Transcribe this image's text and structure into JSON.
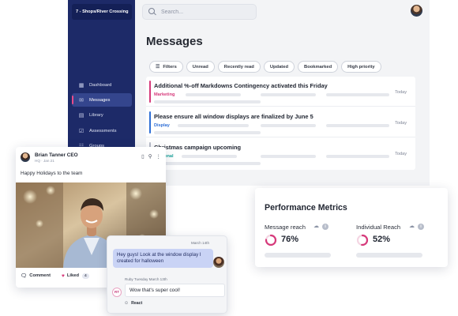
{
  "sidebar": {
    "store": "7 - Shops/River Crossing",
    "items": [
      {
        "label": "Dashboard",
        "icon": "dashboard-icon"
      },
      {
        "label": "Messages",
        "icon": "messages-icon",
        "active": true
      },
      {
        "label": "Library",
        "icon": "library-icon"
      },
      {
        "label": "Assessments",
        "icon": "assessments-icon"
      },
      {
        "label": "Groups",
        "icon": "groups-icon"
      }
    ]
  },
  "topbar": {
    "search_placeholder": "Search...",
    "icons": [
      "messages-icon",
      "clock-icon",
      "bell-icon",
      "user-avatar"
    ]
  },
  "main": {
    "title": "Messages",
    "filters": [
      {
        "label": "Filters",
        "icon": "sliders-icon"
      },
      {
        "label": "Unread"
      },
      {
        "label": "Recently read"
      },
      {
        "label": "Updated"
      },
      {
        "label": "Bookmarked"
      },
      {
        "label": "High priority"
      }
    ],
    "messages": [
      {
        "title": "Additional %-off Markdowns Contingency activated this Friday",
        "tag": "Marketing",
        "tag_color": "#d63a7b",
        "time": "Today",
        "bar_color": "#d63a7b"
      },
      {
        "title": "Please ensure all window displays are finalized by June 5",
        "tag": "Display",
        "tag_color": "#2f6fd6",
        "time": "Today",
        "bar_color": "#2f6fd6"
      },
      {
        "title": "Christmas campaign upcoming",
        "tag": "Seasonal",
        "tag_color": "#1aa39a",
        "time": "Today",
        "bar_color": "#b8bdc9"
      }
    ]
  },
  "performance": {
    "title": "Performance Metrics",
    "metrics": [
      {
        "label": "Message reach",
        "value": "76%",
        "fraction": 0.76,
        "color": "#d63a7b"
      },
      {
        "label": "Individual Reach",
        "value": "52%",
        "fraction": 0.52,
        "color": "#d63a7b"
      }
    ]
  },
  "post": {
    "author": "Brian Tanner CEO",
    "meta": "HQ · Jan 21",
    "text": "Happy Holidays to the team",
    "comment_label": "Comment",
    "liked_label": "Liked",
    "like_count": "4"
  },
  "chat": {
    "first_time": "March 14th",
    "first_text": "Hey guys! Look at the window display I created for halloween",
    "second_meta": "Ruby Tuesday   March 13th",
    "second_initials": "RT",
    "second_text": "Wow that's super cool!",
    "react_label": "React"
  }
}
